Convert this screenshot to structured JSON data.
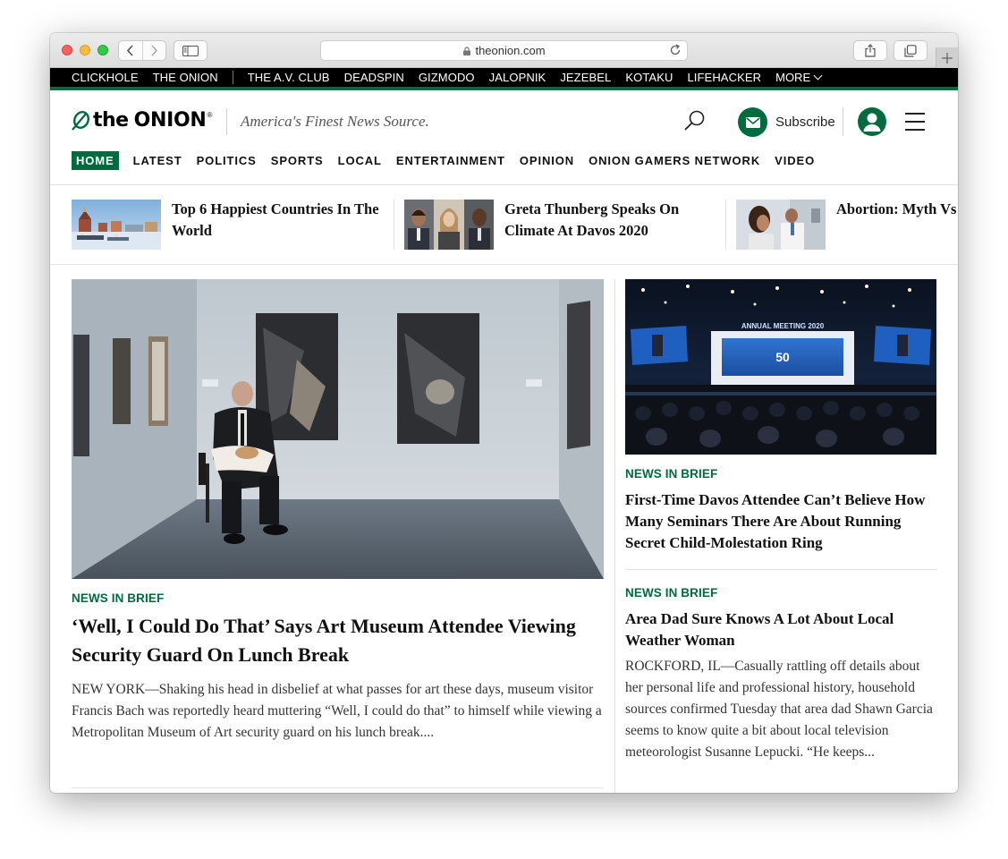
{
  "browser": {
    "url": "theonion.com"
  },
  "network": {
    "links": [
      "CLICKHOLE",
      "THE ONION",
      "THE A.V. CLUB",
      "DEADSPIN",
      "GIZMODO",
      "JALOPNIK",
      "JEZEBEL",
      "KOTAKU",
      "LIFEHACKER",
      "MORE"
    ]
  },
  "header": {
    "logo_the": "the",
    "logo_onion": "ONION",
    "logo_reg": "®",
    "tagline": "America's Finest News Source.",
    "subscribe_label": "Subscribe"
  },
  "nav": [
    "HOME",
    "LATEST",
    "POLITICS",
    "SPORTS",
    "LOCAL",
    "ENTERTAINMENT",
    "OPINION",
    "ONION GAMERS NETWORK",
    "VIDEO"
  ],
  "trending": [
    {
      "title": "Top 6 Happiest Countries In The World"
    },
    {
      "title": "Greta Thunberg Speaks On Climate At Davos 2020"
    },
    {
      "title": "Abortion: Myth Vs"
    }
  ],
  "main_story": {
    "kicker": "NEWS IN BRIEF",
    "headline": "‘Well, I Could Do That’ Says Art Museum Attendee Viewing Security Guard On Lunch Break",
    "excerpt": "NEW YORK—Shaking his head in disbelief at what passes for art these days, museum visitor Francis Bach was reportedly heard muttering “Well, I could do that” to himself while viewing a Metropolitan Museum of Art security guard on his lunch break...."
  },
  "side_stories": [
    {
      "kicker": "NEWS IN BRIEF",
      "headline": "First-Time Davos Attendee Can’t Believe How Many Seminars There Are About Running Secret Child-Molestation Ring",
      "image_caption": "ANNUAL MEETING 2020",
      "image_badge": "50"
    },
    {
      "kicker": "NEWS IN BRIEF",
      "headline": "Area Dad Sure Knows A Lot About Local Weather Woman",
      "excerpt": "ROCKFORD, IL—Casually rattling off details about her personal life and professional history, household sources confirmed Tuesday that area dad Shawn Garcia seems to know quite a bit about local television meteorologist Susanne Lepucki. “He keeps..."
    }
  ],
  "colors": {
    "brand_green": "#006b3f",
    "network_bar": "#000000"
  },
  "icons": [
    "back-icon",
    "forward-icon",
    "sidebar-icon",
    "lock-icon",
    "reload-icon",
    "share-icon",
    "tabs-icon",
    "plus-icon",
    "leaf-logo-icon",
    "search-icon",
    "envelope-icon",
    "user-icon",
    "hamburger-menu-icon",
    "chevron-down-icon"
  ]
}
